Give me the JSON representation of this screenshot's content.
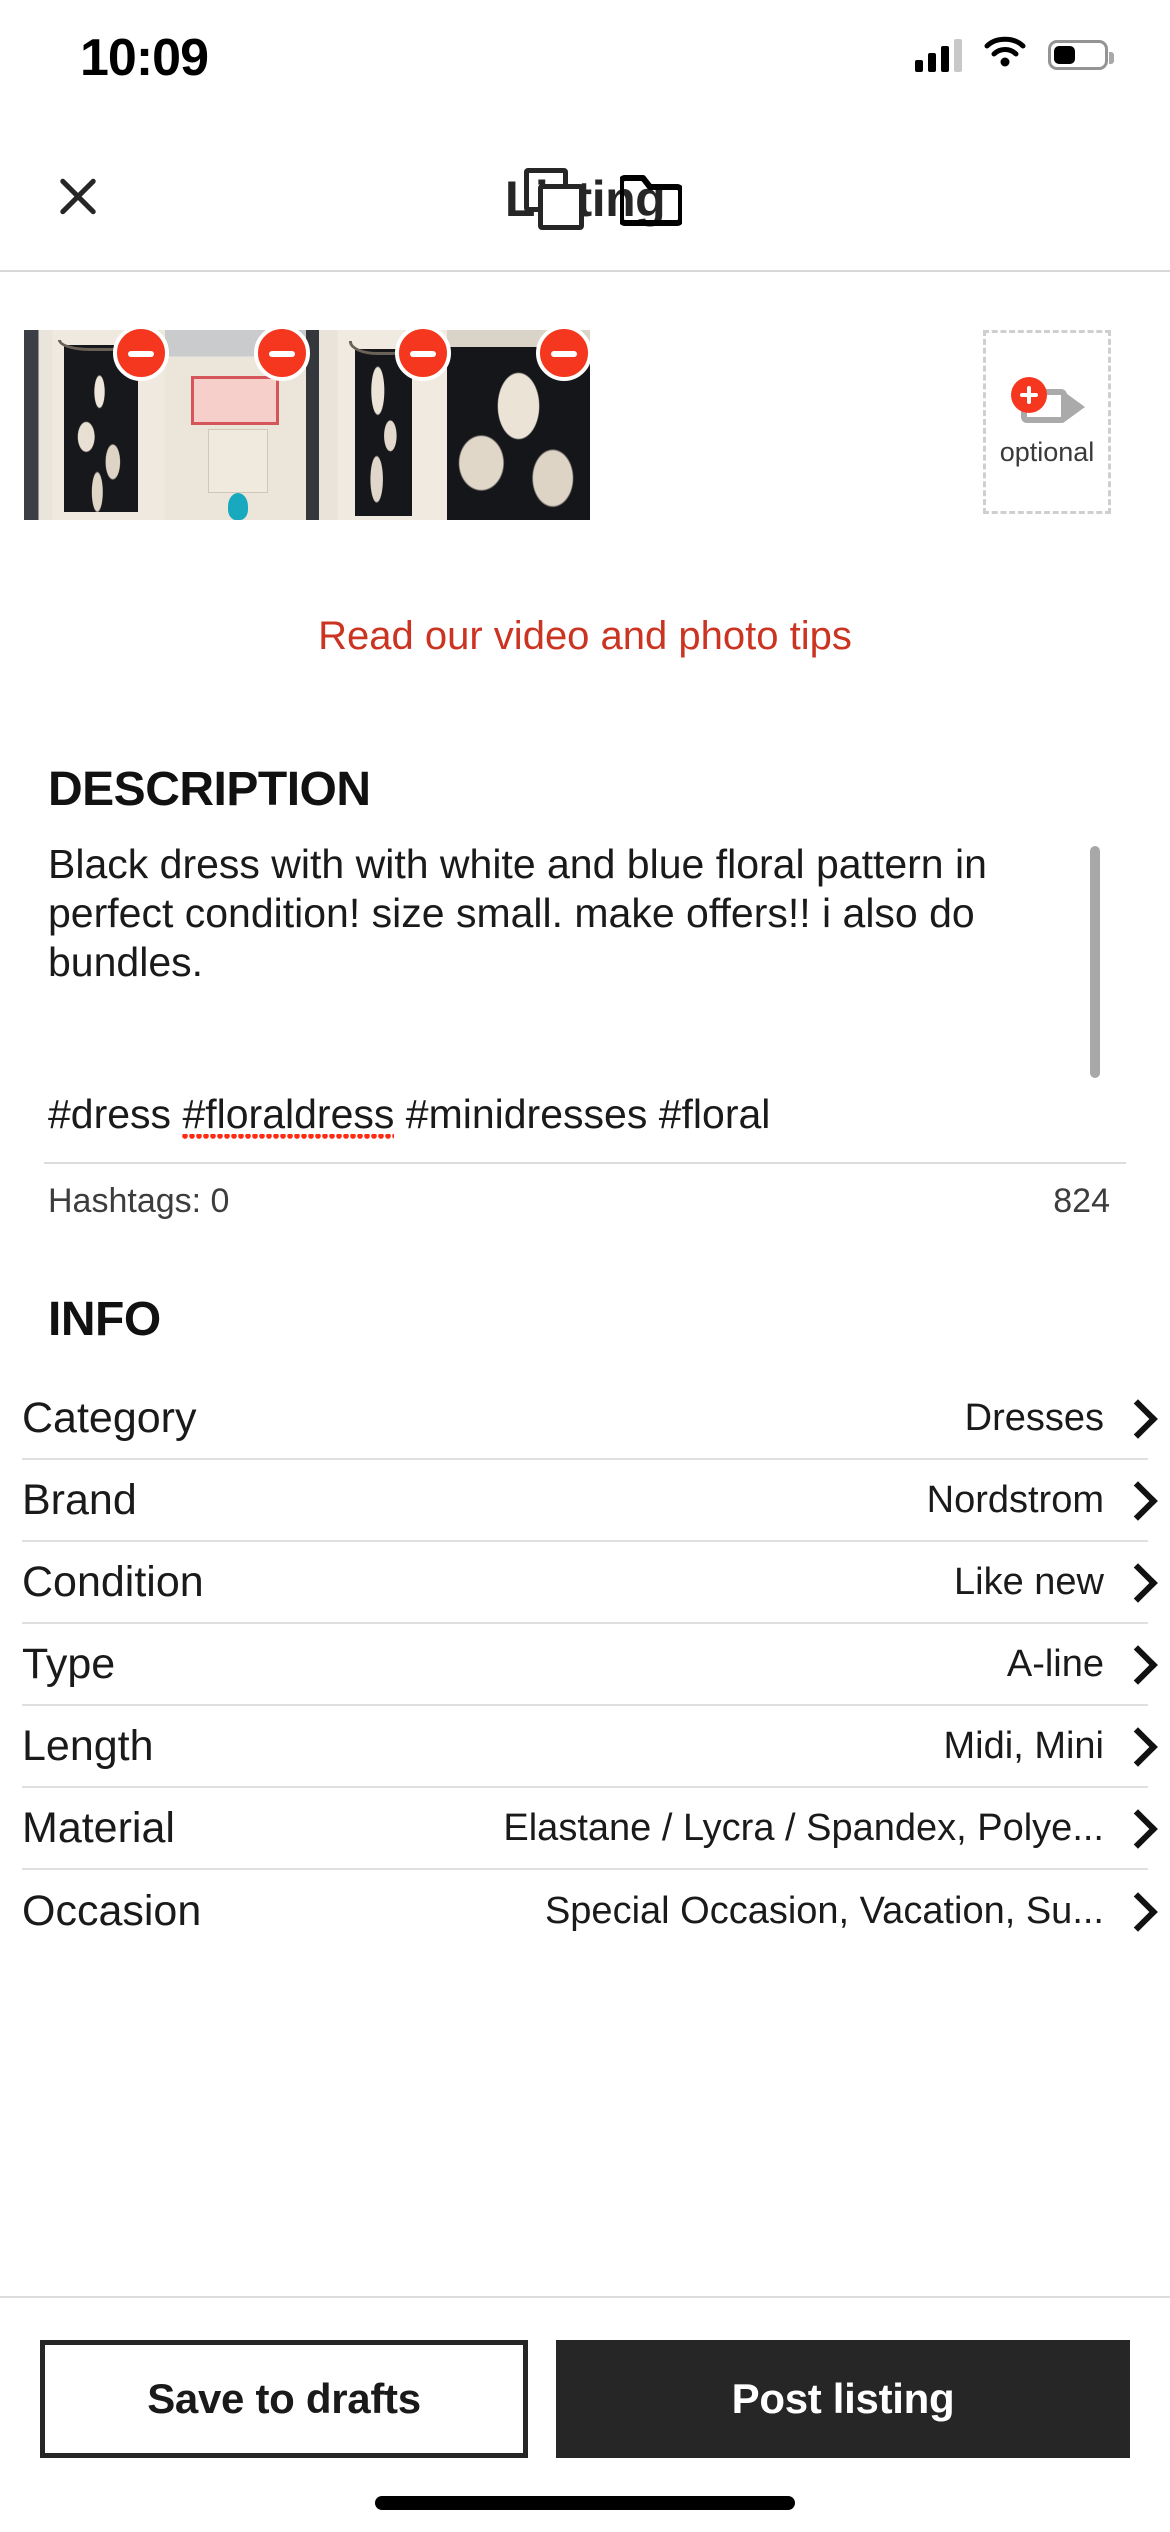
{
  "status_bar": {
    "time": "10:09",
    "signal_icon": "cellular-signal-icon",
    "wifi_icon": "wifi-icon",
    "battery_icon": "battery-icon"
  },
  "header": {
    "title": "Listing",
    "close_icon": "close-icon",
    "copy_icon": "copy-icon",
    "folder_icon": "folder-icon"
  },
  "photos": {
    "items": [
      {
        "alt": "black and white floral dress on hanger",
        "remove_icon": "remove-photo-icon"
      },
      {
        "alt": "garment brand and size label close up",
        "remove_icon": "remove-photo-icon"
      },
      {
        "alt": "dress hanging on door front view",
        "remove_icon": "remove-photo-icon"
      },
      {
        "alt": "floral pattern detail close up",
        "remove_icon": "remove-photo-icon"
      }
    ],
    "video_slot": {
      "label": "optional",
      "icon": "add-video-icon"
    },
    "tips_link": "Read our video and photo tips",
    "tips_link_color": "#cc3422"
  },
  "description": {
    "section_title": "DESCRIPTION",
    "body": "Black dress with with white and blue floral pattern in perfect condition! size small. make offers!! i also do bundles.",
    "hashtags_prefix": "#dress ",
    "hashtags_misspelled": "#floraldress",
    "hashtags_suffix": " #minidresses #floral",
    "hashtags_count_label": "Hashtags: 0",
    "char_count": "824"
  },
  "info": {
    "section_title": "INFO",
    "rows": [
      {
        "label": "Category",
        "value": "Dresses"
      },
      {
        "label": "Brand",
        "value": "Nordstrom"
      },
      {
        "label": "Condition",
        "value": "Like new"
      },
      {
        "label": "Type",
        "value": "A-line"
      },
      {
        "label": "Length",
        "value": "Midi, Mini"
      },
      {
        "label": "Material",
        "value": "Elastane / Lycra / Spandex, Polye..."
      },
      {
        "label": "Occasion",
        "value": "Special Occasion, Vacation, Su..."
      }
    ],
    "chevron_icon": "chevron-right-icon"
  },
  "footer": {
    "save_label": "Save to drafts",
    "post_label": "Post listing",
    "post_bg": "#262626"
  }
}
